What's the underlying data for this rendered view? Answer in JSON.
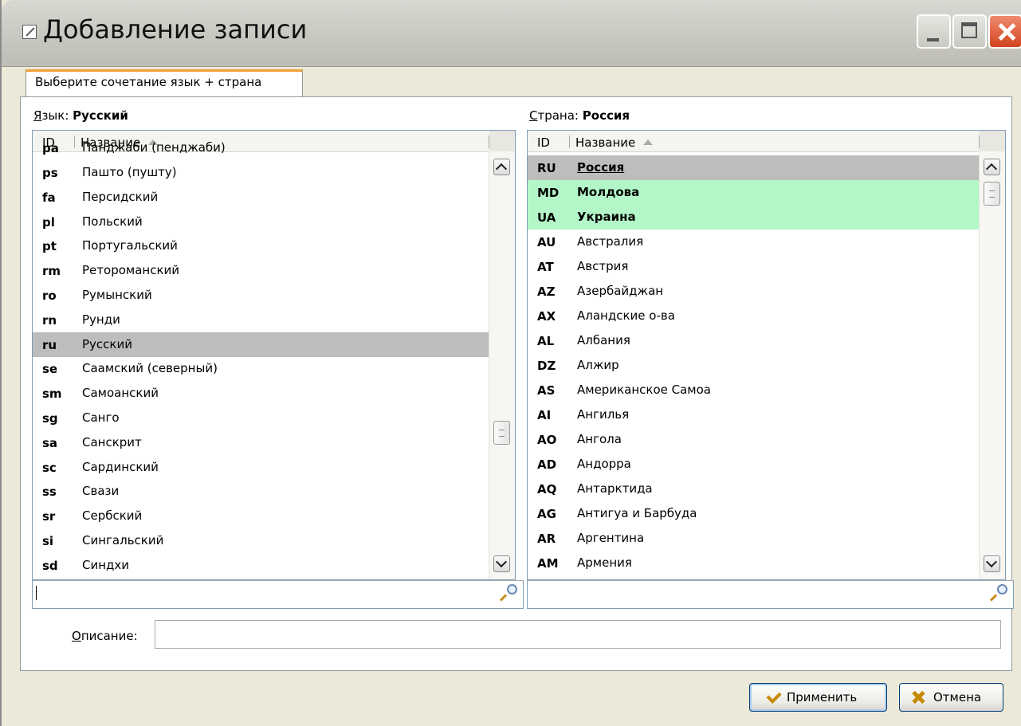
{
  "window": {
    "title": "Добавление записи"
  },
  "tab": {
    "label": "Выберите сочетание язык + страна"
  },
  "language": {
    "label_prefix": "Я",
    "label_rest": "зык:",
    "selected": "Русский",
    "col_id": "ID",
    "col_name": "Название",
    "partial_top": {
      "id": "pa",
      "name": "Панджаби (пенджаби)"
    },
    "rows": [
      {
        "id": "ps",
        "name": "Пашто (пушту)"
      },
      {
        "id": "fa",
        "name": "Персидский"
      },
      {
        "id": "pl",
        "name": "Польский"
      },
      {
        "id": "pt",
        "name": "Португальский"
      },
      {
        "id": "rm",
        "name": "Ретороманский"
      },
      {
        "id": "ro",
        "name": "Румынский"
      },
      {
        "id": "rn",
        "name": "Рунди"
      },
      {
        "id": "ru",
        "name": "Русский"
      },
      {
        "id": "se",
        "name": "Саамский (северный)"
      },
      {
        "id": "sm",
        "name": "Самоанский"
      },
      {
        "id": "sg",
        "name": "Санго"
      },
      {
        "id": "sa",
        "name": "Санскрит"
      },
      {
        "id": "sc",
        "name": "Сардинский"
      },
      {
        "id": "ss",
        "name": "Свази"
      },
      {
        "id": "sr",
        "name": "Сербский"
      },
      {
        "id": "si",
        "name": "Сингальский"
      }
    ],
    "partial_bottom": {
      "id": "sd",
      "name": "Синдхи"
    },
    "filter_value": ""
  },
  "country": {
    "label_prefix": "С",
    "label_rest": "трана:",
    "selected": "Россия",
    "col_id": "ID",
    "col_name": "Название",
    "rows": [
      {
        "id": "RU",
        "name": "Россия"
      },
      {
        "id": "MD",
        "name": "Молдова"
      },
      {
        "id": "UA",
        "name": "Украина"
      },
      {
        "id": "AU",
        "name": "Австралия"
      },
      {
        "id": "AT",
        "name": "Австрия"
      },
      {
        "id": "AZ",
        "name": "Азербайджан"
      },
      {
        "id": "AX",
        "name": "Аландские о-ва"
      },
      {
        "id": "AL",
        "name": "Албания"
      },
      {
        "id": "DZ",
        "name": "Алжир"
      },
      {
        "id": "AS",
        "name": "Американское Самоа"
      },
      {
        "id": "AI",
        "name": "Ангилья"
      },
      {
        "id": "AO",
        "name": "Ангола"
      },
      {
        "id": "AD",
        "name": "Андорра"
      },
      {
        "id": "AQ",
        "name": "Антарктида"
      },
      {
        "id": "AG",
        "name": "Антигуа и Барбуда"
      },
      {
        "id": "AR",
        "name": "Аргентина"
      },
      {
        "id": "AM",
        "name": "Армения"
      }
    ],
    "filter_value": ""
  },
  "description": {
    "label_prefix": "О",
    "label_rest": "писание:",
    "value": ""
  },
  "buttons": {
    "apply": "Применить",
    "cancel": "Отмена"
  }
}
